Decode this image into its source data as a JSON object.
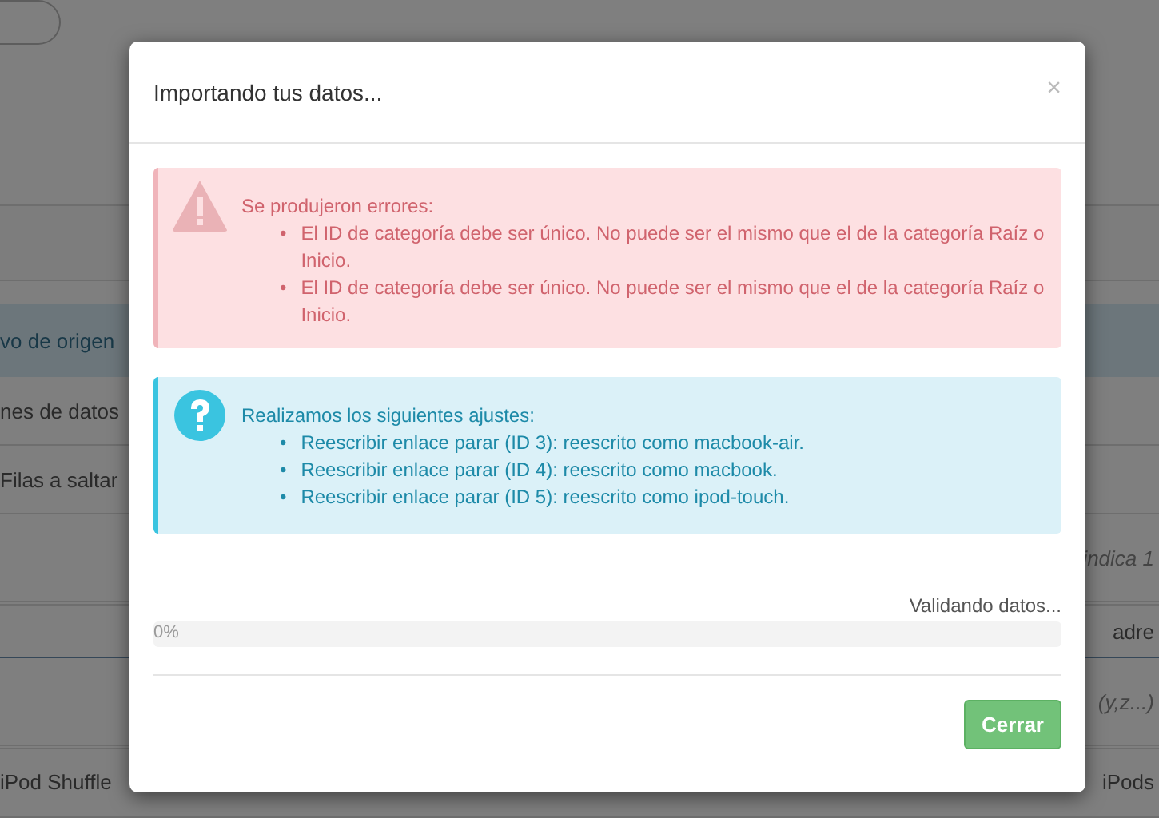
{
  "background": {
    "rows": [
      {
        "kind": "pill"
      },
      {
        "kind": "blank"
      },
      {
        "kind": "rule"
      },
      {
        "kind": "band",
        "left": "vo de origen"
      },
      {
        "kind": "text",
        "left": "nes de datos"
      },
      {
        "kind": "text",
        "left": " Filas a saltar"
      },
      {
        "kind": "hint",
        "right": "indica 1"
      },
      {
        "kind": "header",
        "right": "adre"
      },
      {
        "kind": "hint",
        "right": "(y,z...)"
      },
      {
        "kind": "text",
        "left": "iPod Shuffle",
        "right": "iPods"
      }
    ]
  },
  "modal": {
    "title": "Importando tus datos...",
    "close": "×",
    "bullet": "•",
    "alerts": [
      {
        "kind": "error",
        "heading": "Se produjeron errores:",
        "items": [
          "El ID de categoría debe ser único. No puede ser el mismo que el de la categoría Raíz o Inicio.",
          "El ID de categoría debe ser único. No puede ser el mismo que el de la categoría Raíz o Inicio."
        ]
      },
      {
        "kind": "info",
        "heading": "Realizamos los siguientes ajustes:",
        "items": [
          "Reescribir enlace parar (ID 3): reescrito como macbook-air.",
          "Reescribir enlace parar (ID 4): reescrito como macbook.",
          "Reescribir enlace parar (ID 5): reescrito como ipod-touch."
        ]
      }
    ],
    "progress": {
      "status": "Validando datos...",
      "label": "0%",
      "level": 0
    },
    "buttons": [
      "Cerrar"
    ]
  }
}
